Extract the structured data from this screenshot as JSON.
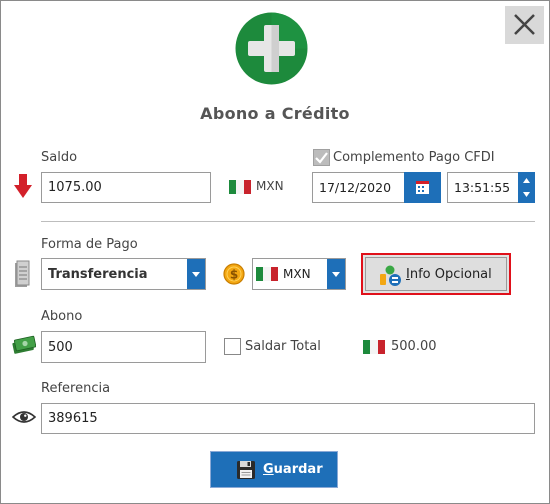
{
  "dialog": {
    "title": "Abono a Crédito",
    "close_icon": "close-icon",
    "logo_icon": "plus-circle-icon",
    "accent_color": "#1e6fb8",
    "logo_color": "#1d8a3c"
  },
  "saldo": {
    "label": "Saldo",
    "value": "1075.00",
    "currency": "MXN",
    "indicator_icon": "red-down-arrow-icon"
  },
  "cfdi": {
    "label": "Complemento Pago CFDI",
    "checked": true,
    "date": "17/12/2020",
    "time": "13:51:55",
    "calendar_icon": "calendar-icon"
  },
  "forma_pago": {
    "label": "Forma de Pago",
    "selected": "Transferencia",
    "currency_selected": "MXN",
    "coin_icon": "dollar-coin-icon"
  },
  "info_opcional": {
    "label": "Info Opcional",
    "accel": "I",
    "rest": "nfo Opcional"
  },
  "abono": {
    "label": "Abono",
    "value": "500",
    "saldar_total_label": "Saldar Total",
    "saldar_total_checked": false,
    "total": "500.00",
    "money_icon": "money-icon"
  },
  "referencia": {
    "label": "Referencia",
    "value": "389615",
    "eye_icon": "eye-icon"
  },
  "guardar": {
    "label": "Guardar",
    "accel": "G",
    "rest": "uardar",
    "save_icon": "floppy-disk-icon"
  }
}
